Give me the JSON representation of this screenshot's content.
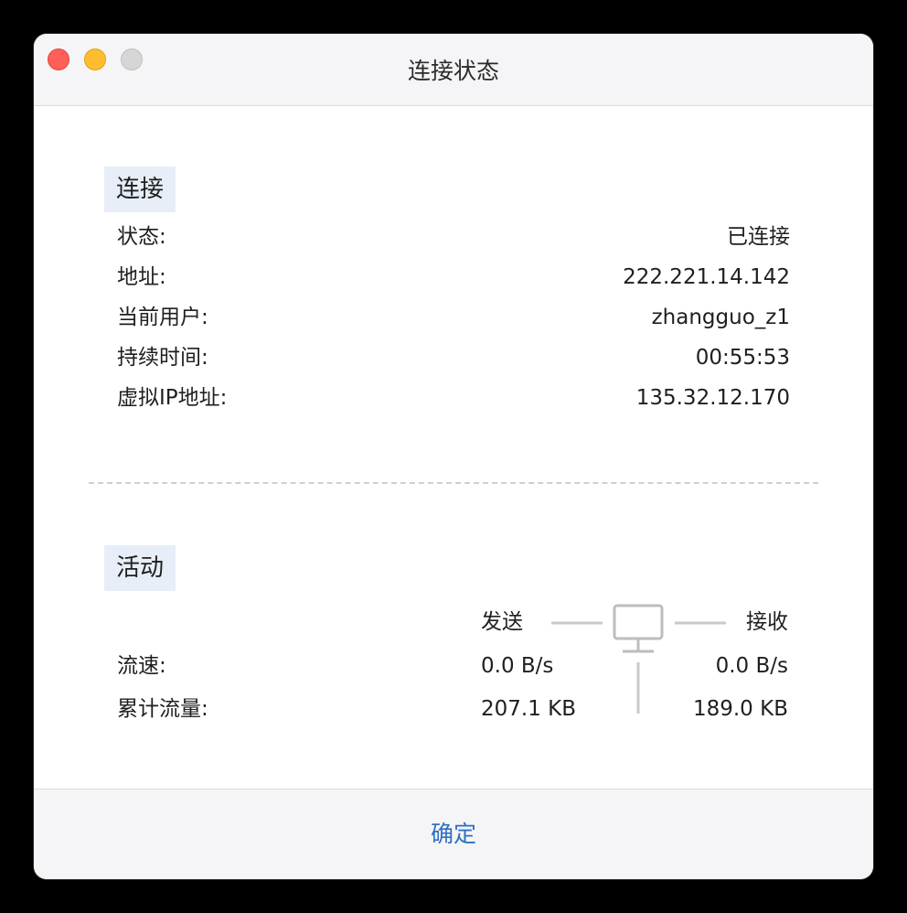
{
  "window": {
    "title": "连接状态"
  },
  "connection": {
    "section_label": "连接",
    "rows": [
      {
        "label": "状态:",
        "value": "已连接"
      },
      {
        "label": "地址:",
        "value": "222.221.14.142"
      },
      {
        "label": "当前用户:",
        "value": "zhangguo_z1"
      },
      {
        "label": "持续时间:",
        "value": "00:55:53"
      },
      {
        "label": "虚拟IP地址:",
        "value": "135.32.12.170"
      }
    ]
  },
  "activity": {
    "section_label": "活动",
    "send_header": "发送",
    "receive_header": "接收",
    "rows": [
      {
        "label": "流速:",
        "send": "0.0 B/s",
        "receive": "0.0 B/s"
      },
      {
        "label": "累计流量:",
        "send": "207.1 KB",
        "receive": "189.0 KB"
      }
    ]
  },
  "footer": {
    "ok_label": "确定"
  },
  "icons": {
    "network": "monitor-icon"
  },
  "colors": {
    "close": "#fe5f57",
    "minimize": "#febc2e",
    "zoom": "#d6d6d6",
    "accent": "#2f6fc4",
    "section_chip": "#e7eef8"
  }
}
